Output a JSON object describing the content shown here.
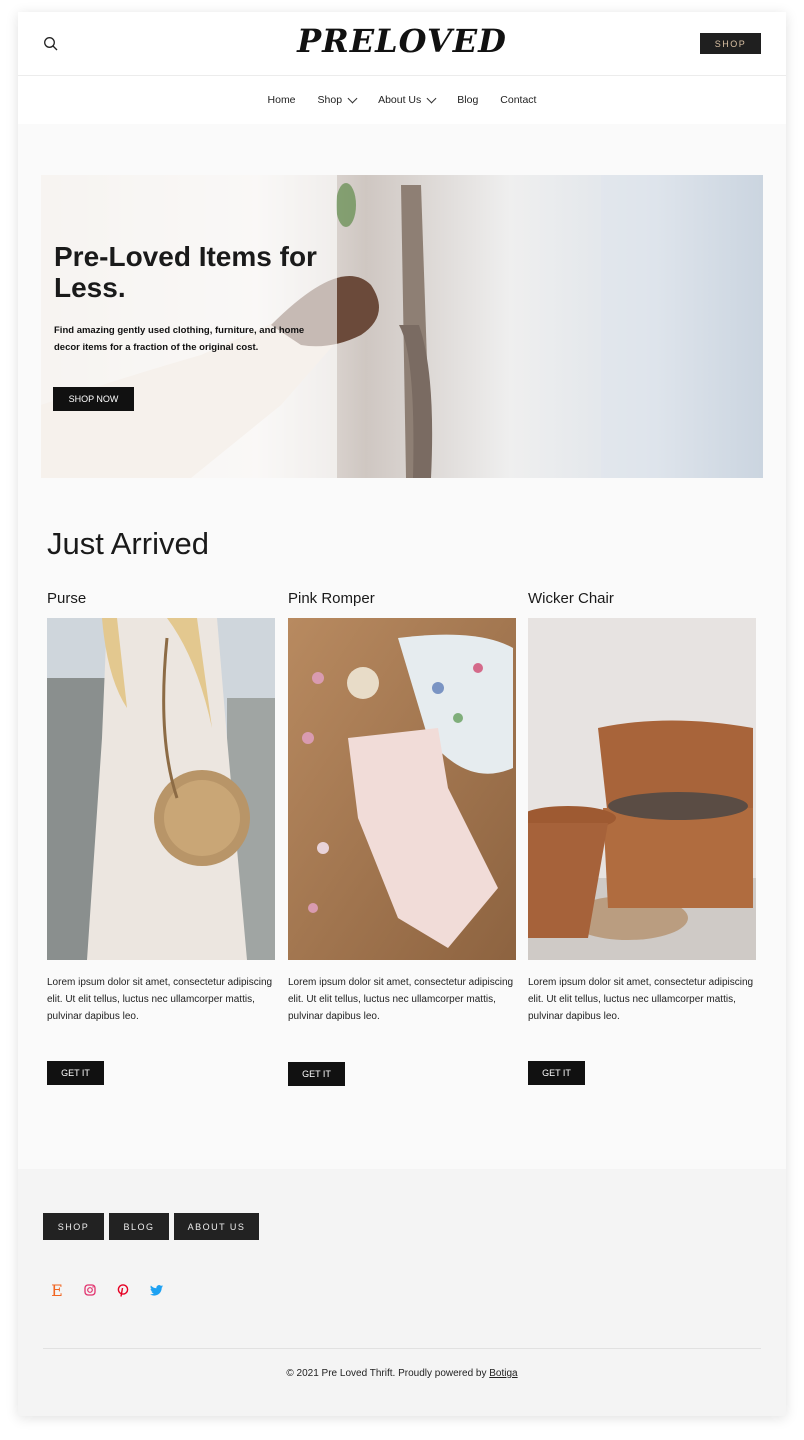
{
  "header": {
    "logo": "PRELOVED",
    "shop_label": "SHOP",
    "search_icon": "search-icon"
  },
  "nav": {
    "items": [
      {
        "label": "Home",
        "has_dropdown": false
      },
      {
        "label": "Shop",
        "has_dropdown": true
      },
      {
        "label": "About Us",
        "has_dropdown": true
      },
      {
        "label": "Blog",
        "has_dropdown": false
      },
      {
        "label": "Contact",
        "has_dropdown": false
      }
    ]
  },
  "hero": {
    "title": "Pre-Loved Items for Less.",
    "subtitle": "Find amazing gently used clothing, furniture, and home decor items for a fraction of the original cost.",
    "button_label": "SHOP NOW"
  },
  "arrivals": {
    "title": "Just Arrived",
    "products": [
      {
        "name": "Purse",
        "description": "Lorem ipsum dolor sit amet, consectetur adipiscing elit. Ut elit tellus, luctus nec ullamcorper mattis, pulvinar dapibus leo.",
        "button_label": "GET IT"
      },
      {
        "name": "Pink Romper",
        "description": "Lorem ipsum dolor sit amet, consectetur adipiscing elit. Ut elit tellus, luctus nec ullamcorper mattis, pulvinar dapibus leo.",
        "button_label": "GET IT"
      },
      {
        "name": "Wicker Chair",
        "description": "Lorem ipsum dolor sit amet, consectetur adipiscing elit. Ut elit tellus, luctus nec ullamcorper mattis, pulvinar dapibus leo.",
        "button_label": "GET IT"
      }
    ]
  },
  "footer": {
    "buttons": [
      "SHOP",
      "BLOG",
      "ABOUT US"
    ],
    "social": [
      {
        "icon": "etsy-icon",
        "glyph": "E",
        "color": "#f16521"
      },
      {
        "icon": "instagram-icon",
        "glyph": "◎",
        "color": "#e1306c"
      },
      {
        "icon": "pinterest-icon",
        "glyph": "℗",
        "color": "#e60023"
      },
      {
        "icon": "twitter-icon",
        "glyph": "🐦",
        "color": "#1da1f2"
      }
    ],
    "copyright_prefix": "© 2021 Pre Loved Thrift. Proudly powered by ",
    "copyright_link": "Botiga"
  },
  "colors": {
    "accent": "#111111",
    "shop_button_text": "#d9c0a3"
  }
}
